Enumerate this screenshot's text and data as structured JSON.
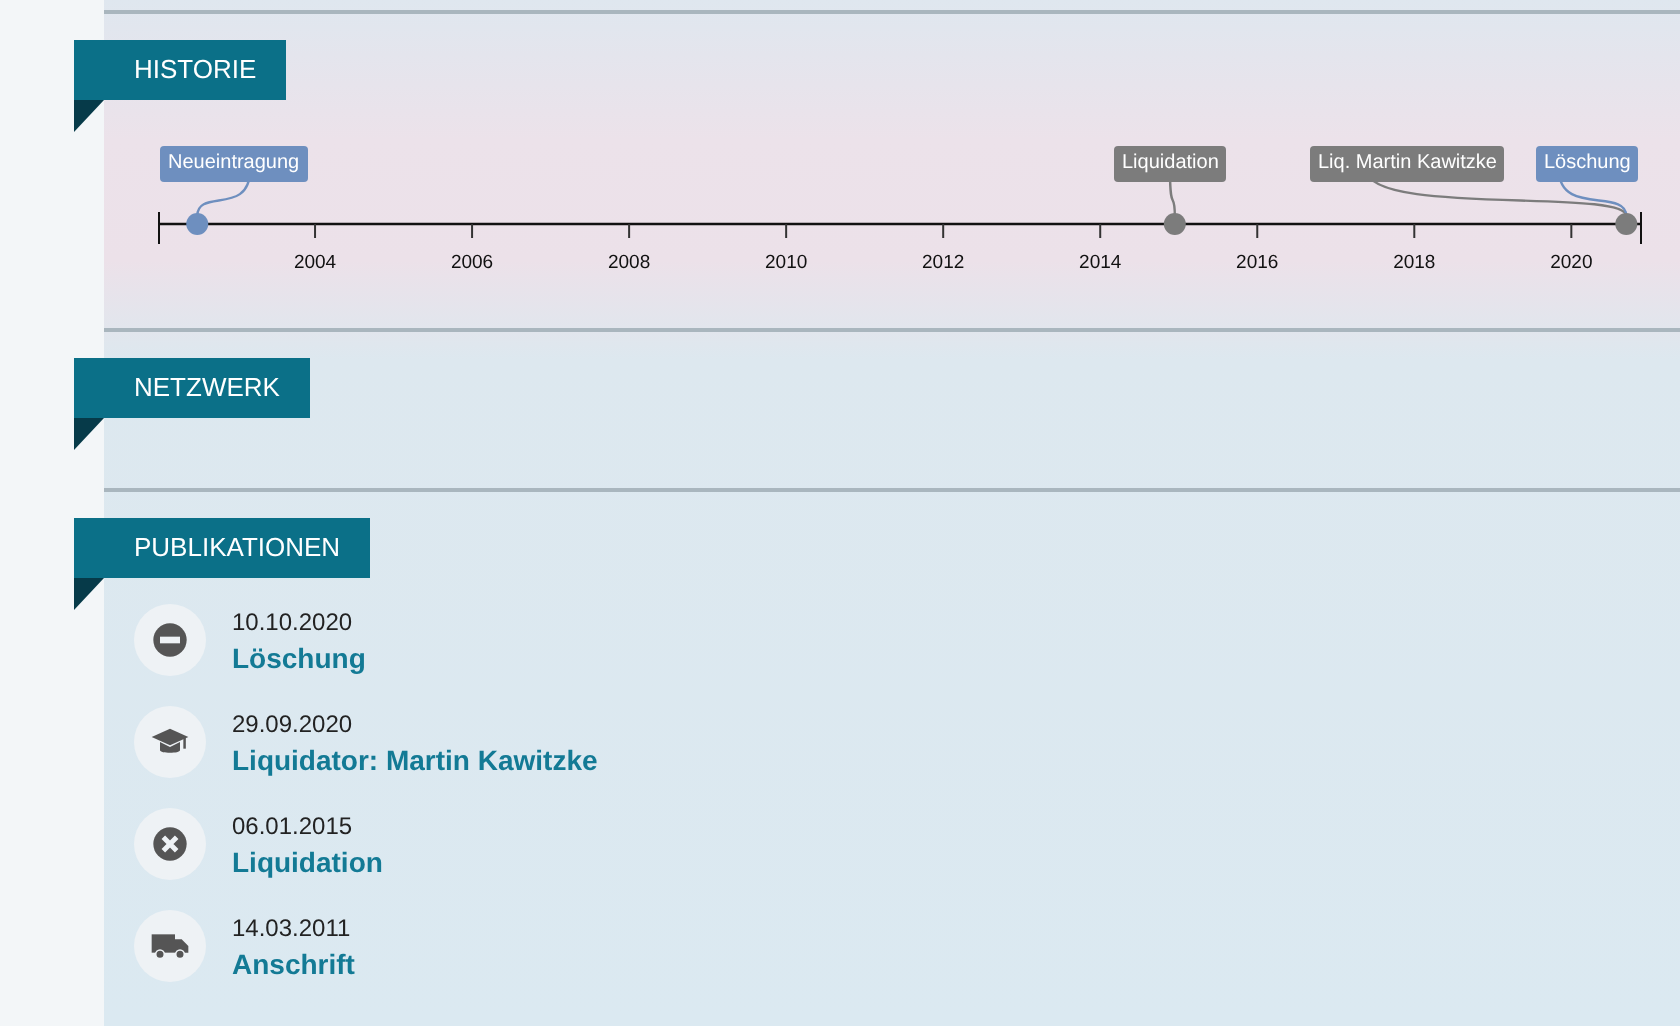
{
  "sections": [
    {
      "title": "HISTORIE",
      "kind": "timeline",
      "timeline": {
        "ticks": [
          "2004",
          "2006",
          "2008",
          "2010",
          "2012",
          "2014",
          "2016",
          "2018",
          "2020"
        ],
        "events": [
          {
            "label": "Neueintragung",
            "color": "#6e8fbf"
          },
          {
            "label": "Liquidation",
            "color": "#7c7c7c"
          },
          {
            "label": "Liq. Martin Kawitzke",
            "color": "#7c7c7c"
          },
          {
            "label": "Löschung",
            "color": "#6e8fbf"
          }
        ]
      }
    },
    {
      "title": "NETZWERK",
      "kind": "empty"
    },
    {
      "title": "PUBLIKATIONEN",
      "kind": "publications",
      "items": [
        {
          "date": "10.10.2020",
          "title": "Löschung",
          "kind": "minus"
        },
        {
          "date": "29.09.2020",
          "title": "Liquidator: Martin Kawitzke",
          "kind": "cap"
        },
        {
          "date": "06.01.2015",
          "title": "Liquidation",
          "kind": "cross"
        },
        {
          "date": "14.03.2011",
          "title": "Anschrift",
          "kind": "truck"
        }
      ]
    }
  ]
}
